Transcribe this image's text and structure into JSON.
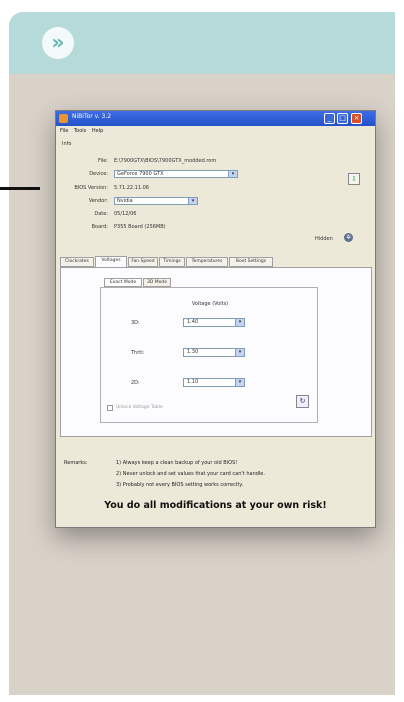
{
  "badge": {
    "glyph": "»",
    "icon": "chevrons-right-icon"
  },
  "window": {
    "title": "NiBiTor v. 3.2",
    "menu": [
      "File",
      "Tools",
      "Help"
    ],
    "controls": {
      "min": "_",
      "max": "□",
      "close": "×"
    }
  },
  "info": {
    "group_label": "Info",
    "rows": [
      {
        "label": "File:",
        "value": "E:\\7900GTX\\BIOS\\7900GTX_modded.rom"
      },
      {
        "label": "Device:",
        "value": "GeForce 7900 GTX",
        "type": "select"
      },
      {
        "label": "BIOS Version:",
        "value": "5.71.22.11.06"
      },
      {
        "label": "Vendor:",
        "value": "Nvidia",
        "type": "select"
      },
      {
        "label": "Date:",
        "value": "05/12/06"
      },
      {
        "label": "Board:",
        "value": "P355 Board (256MB)"
      }
    ],
    "side_label": "Hidden"
  },
  "tabs": [
    "Clockrates",
    "Voltages",
    "Fan Speed",
    "Timings",
    "Temperatures",
    "Boot Settings"
  ],
  "active_tab": "Voltages",
  "subtabs": [
    "Exact Mode",
    "3D Mode"
  ],
  "voltages": {
    "header": "Voltage (Volts)",
    "rows": [
      {
        "label": "3D:",
        "value": "1.40"
      },
      {
        "label": "Thrtl:",
        "value": "1.30"
      },
      {
        "label": "2D:",
        "value": "1.10"
      }
    ],
    "checkbox_label": "Unlock Voltage Table",
    "apply_glyph": "↻"
  },
  "remarks": {
    "label": "Remarks:",
    "lines": [
      "1) Always keep a clean backup of your old BIOS!",
      "2) Never unlock and set values that your card can't handle.",
      "3) Probably not every BIOS setting works correctly."
    ],
    "warning": "You do all modifications at your own risk!"
  }
}
